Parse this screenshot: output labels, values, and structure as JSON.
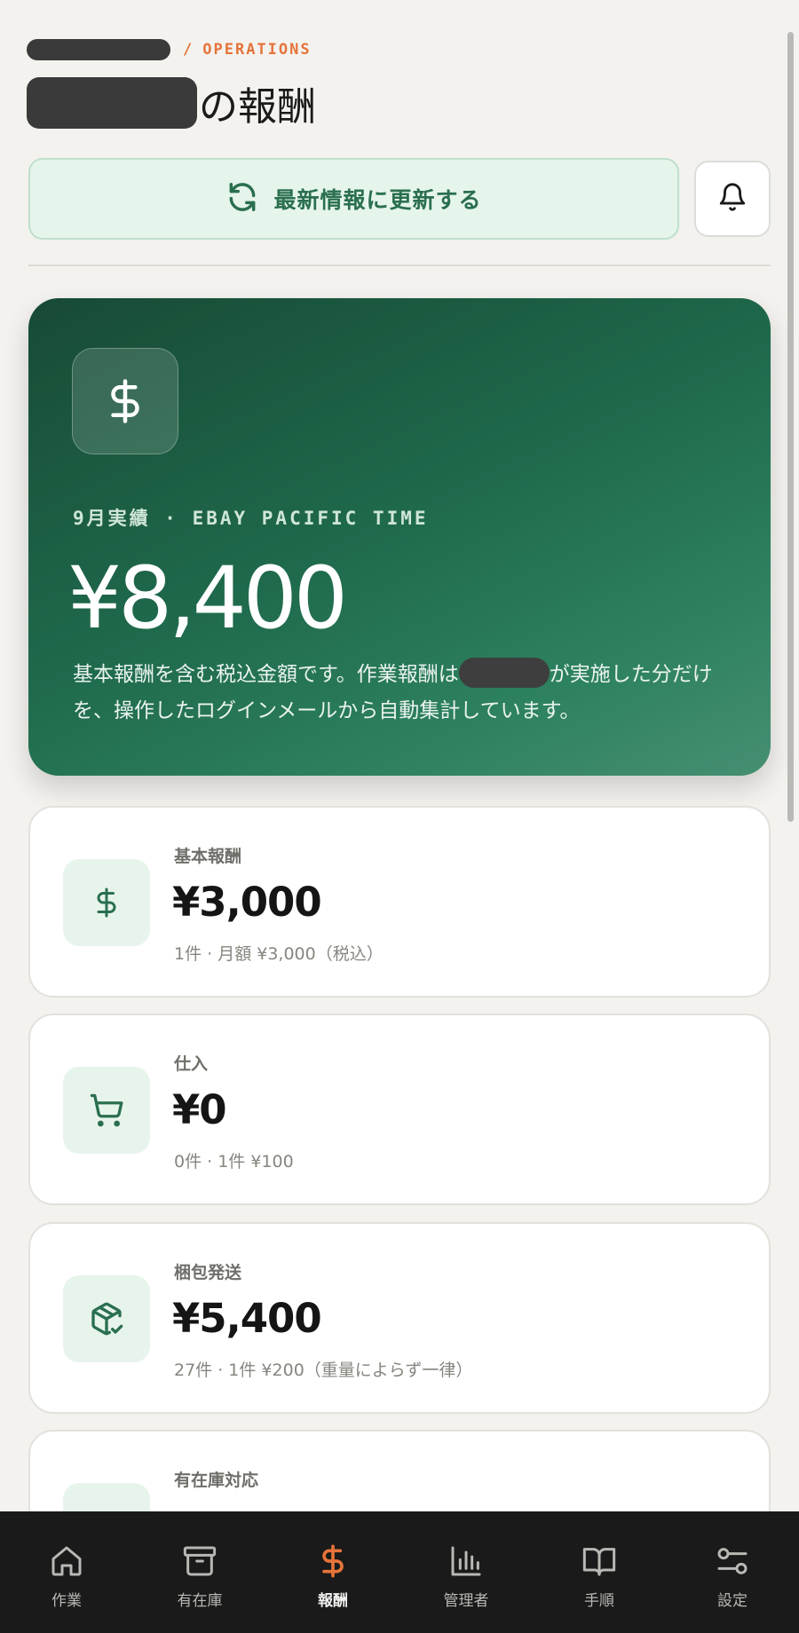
{
  "header": {
    "breadcrumb_section": "OPERATIONS",
    "breadcrumb_separator": "/",
    "title_suffix": "の報酬"
  },
  "actions": {
    "refresh_label": "最新情報に更新する"
  },
  "hero": {
    "period_label": "9月実績 · EBAY PACIFIC TIME",
    "amount": "¥8,400",
    "desc_before": "基本報酬を含む税込金額です。作業報酬は",
    "desc_after": "が実施した分だけを、操作したログインメールから自動集計しています。"
  },
  "cards": [
    {
      "label": "基本報酬",
      "amount": "¥3,000",
      "note": "1件 · 月額 ¥3,000（税込）",
      "icon": "dollar-icon"
    },
    {
      "label": "仕入",
      "amount": "¥0",
      "note": "0件 · 1件 ¥100",
      "icon": "cart-icon"
    },
    {
      "label": "梱包発送",
      "amount": "¥5,400",
      "note": "27件 · 1件 ¥200（重量によらず一律）",
      "icon": "package-check-icon"
    },
    {
      "label": "有在庫対応",
      "amount": "",
      "note": "",
      "icon": "archive-icon"
    }
  ],
  "nav": {
    "items": [
      {
        "label": "作業",
        "icon": "home-icon"
      },
      {
        "label": "有在庫",
        "icon": "archive-icon"
      },
      {
        "label": "報酬",
        "icon": "dollar-icon",
        "active": true
      },
      {
        "label": "管理者",
        "icon": "bar-chart-icon"
      },
      {
        "label": "手順",
        "icon": "book-icon"
      },
      {
        "label": "設定",
        "icon": "settings-sliders-icon"
      }
    ]
  },
  "colors": {
    "accent_orange": "#e5733a",
    "green_dark": "#184a35",
    "green_text": "#2a6f4f",
    "green_soft": "#e7f4ec",
    "nav_bg": "#191a19"
  }
}
